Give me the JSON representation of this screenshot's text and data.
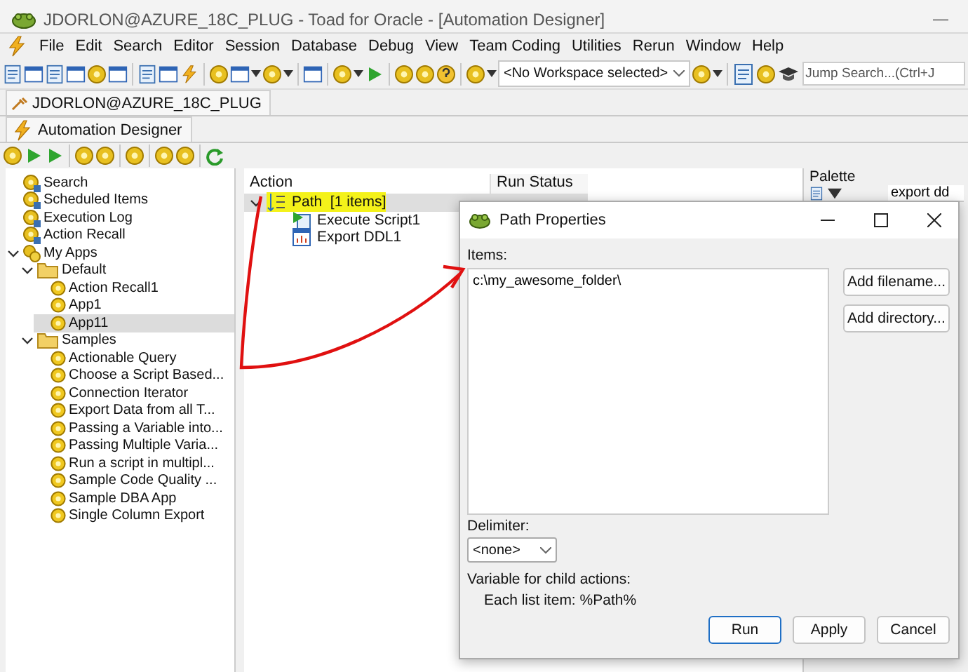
{
  "window": {
    "title": "JDORLON@AZURE_18C_PLUG - Toad for Oracle - [Automation Designer]",
    "minimize": "—"
  },
  "menu": [
    "File",
    "Edit",
    "Search",
    "Editor",
    "Session",
    "Database",
    "Debug",
    "View",
    "Team Coding",
    "Utilities",
    "Rerun",
    "Window",
    "Help"
  ],
  "toolbar": {
    "workspace": "<No Workspace selected>",
    "jump_search": {
      "placeholder": "Jump Search...(Ctrl+J"
    }
  },
  "connection_tab": "JDORLON@AZURE_18C_PLUG",
  "document_tab": "Automation Designer",
  "tree": [
    {
      "label": "Search",
      "kind": "tool",
      "selected": false
    },
    {
      "label": "Scheduled Items",
      "kind": "tool",
      "selected": false
    },
    {
      "label": "Execution Log",
      "kind": "tool",
      "selected": false
    },
    {
      "label": "Action Recall",
      "kind": "tool",
      "selected": false
    },
    {
      "label": "My Apps",
      "kind": "apps",
      "selected": false,
      "expanded": true,
      "children": [
        {
          "label": "Default",
          "kind": "folder",
          "selected": false,
          "expanded": true,
          "children": [
            {
              "label": "Action Recall1",
              "kind": "app",
              "selected": false
            },
            {
              "label": "App1",
              "kind": "app",
              "selected": false
            },
            {
              "label": "App11",
              "kind": "app",
              "selected": true
            }
          ]
        },
        {
          "label": "Samples",
          "kind": "folder",
          "selected": false,
          "expanded": true,
          "children": [
            {
              "label": "Actionable Query",
              "kind": "app",
              "selected": false
            },
            {
              "label": "Choose a Script Based...",
              "kind": "app",
              "selected": false
            },
            {
              "label": "Connection Iterator",
              "kind": "app",
              "selected": false
            },
            {
              "label": "Export Data from all T...",
              "kind": "app",
              "selected": false
            },
            {
              "label": "Passing a Variable into...",
              "kind": "app",
              "selected": false
            },
            {
              "label": "Passing Multiple Varia...",
              "kind": "app",
              "selected": false
            },
            {
              "label": "Run a script in multipl...",
              "kind": "app",
              "selected": false
            },
            {
              "label": "Sample Code Quality ...",
              "kind": "app",
              "selected": false
            },
            {
              "label": "Sample DBA App",
              "kind": "app",
              "selected": false
            },
            {
              "label": "Single Column Export",
              "kind": "app",
              "selected": false
            }
          ]
        }
      ]
    }
  ],
  "actions": {
    "columns": [
      "Action",
      "Run Status"
    ],
    "rows": [
      {
        "label": "Path  [1 items]",
        "kind": "path",
        "selected": true,
        "highlighted": true,
        "expanded": true,
        "children": [
          {
            "label": "Execute Script1",
            "kind": "script",
            "selected": false,
            "highlighted": false
          },
          {
            "label": "Export DDL1",
            "kind": "ddl",
            "selected": false,
            "highlighted": false
          }
        ]
      }
    ]
  },
  "palette": {
    "title": "Palette",
    "search": "export dd"
  },
  "dialog": {
    "title": "Path Properties",
    "items_label": "Items:",
    "items": "c:\\my_awesome_folder\\",
    "side_buttons": [
      "Add filename...",
      "Add directory..."
    ],
    "delimiter_label": "Delimiter:",
    "delimiter": "<none>",
    "variable_label": "Variable for child actions:",
    "variable_text": "Each list item: %Path%",
    "buttons": [
      {
        "label": "Run",
        "default": true
      },
      {
        "label": "Apply",
        "default": false
      },
      {
        "label": "Cancel",
        "default": false
      }
    ]
  }
}
